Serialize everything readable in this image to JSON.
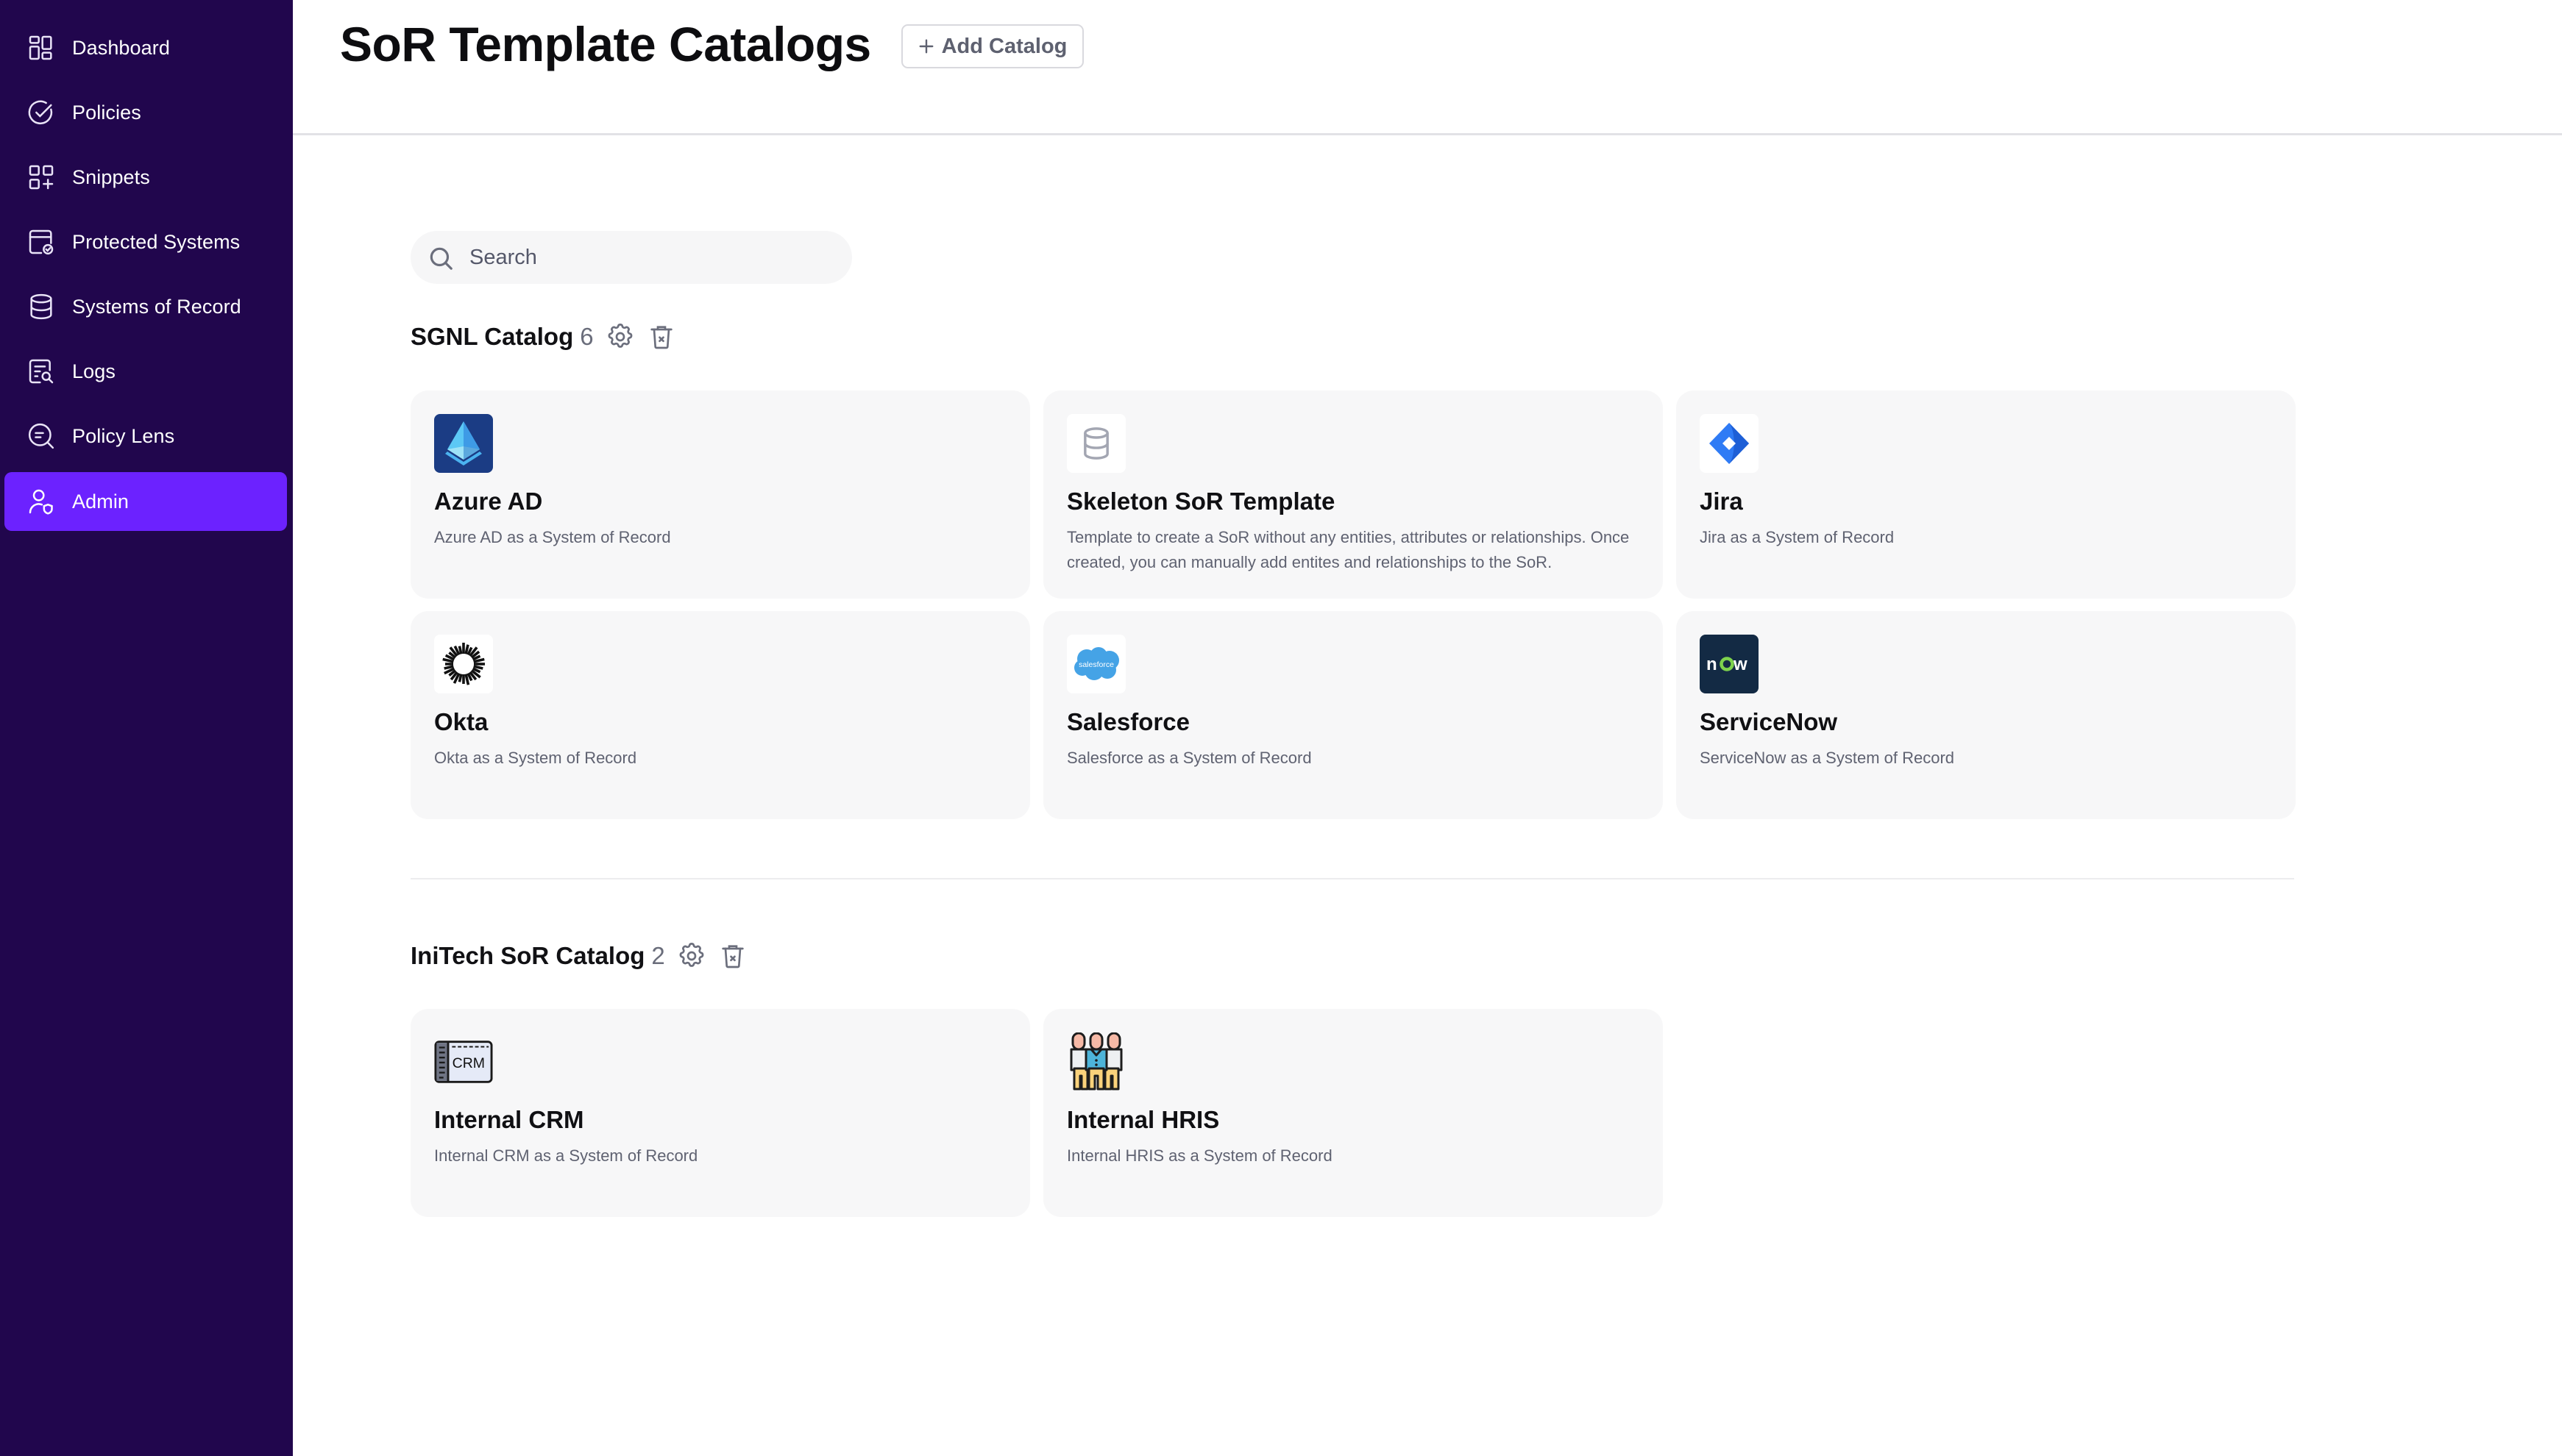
{
  "sidebar": {
    "items": [
      {
        "label": "Dashboard",
        "icon": "dashboard-icon",
        "active": false
      },
      {
        "label": "Policies",
        "icon": "check-circle-icon",
        "active": false
      },
      {
        "label": "Snippets",
        "icon": "snippets-icon",
        "active": false
      },
      {
        "label": "Protected Systems",
        "icon": "protected-systems-icon",
        "active": false
      },
      {
        "label": "Systems of Record",
        "icon": "database-icon",
        "active": false
      },
      {
        "label": "Logs",
        "icon": "logs-icon",
        "active": false
      },
      {
        "label": "Policy Lens",
        "icon": "policy-lens-icon",
        "active": false
      },
      {
        "label": "Admin",
        "icon": "admin-user-icon",
        "active": true
      }
    ]
  },
  "header": {
    "title": "SoR Template Catalogs",
    "add_button_label": "Add Catalog"
  },
  "search": {
    "placeholder": "Search",
    "value": ""
  },
  "catalogs": [
    {
      "name": "SGNL Catalog",
      "count": "6",
      "templates": [
        {
          "title": "Azure AD",
          "description": "Azure AD as a System of Record",
          "icon": "azure-ad-logo-icon"
        },
        {
          "title": "Skeleton SoR Template",
          "description": "Template to create a SoR without any entities, attributes or relationships. Once created, you can manually add entites and relationships to the SoR.",
          "icon": "database-icon"
        },
        {
          "title": "Jira",
          "description": "Jira as a System of Record",
          "icon": "jira-logo-icon"
        },
        {
          "title": "Okta",
          "description": "Okta as a System of Record",
          "icon": "okta-logo-icon"
        },
        {
          "title": "Salesforce",
          "description": "Salesforce as a System of Record",
          "icon": "salesforce-logo-icon"
        },
        {
          "title": "ServiceNow",
          "description": "ServiceNow as a System of Record",
          "icon": "servicenow-logo-icon"
        }
      ]
    },
    {
      "name": "IniTech SoR Catalog",
      "count": "2",
      "templates": [
        {
          "title": "Internal CRM",
          "description": "Internal CRM as a System of Record",
          "icon": "crm-icon"
        },
        {
          "title": "Internal HRIS",
          "description": "Internal HRIS as a System of Record",
          "icon": "hris-people-icon"
        }
      ]
    }
  ],
  "logo_text": {
    "salesforce": "salesforce",
    "servicenow_n": "n",
    "servicenow_w": "w",
    "crm": "CRM"
  },
  "colors": {
    "sidebar_bg": "#21064D",
    "active_item": "#6C22FF",
    "card_bg": "#F7F7F8",
    "muted_text": "#5F6271"
  }
}
